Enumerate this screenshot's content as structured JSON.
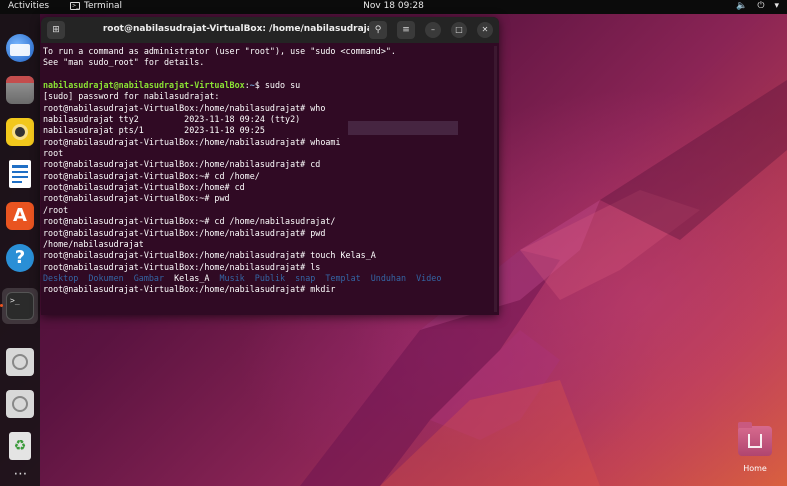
{
  "topbar": {
    "activities": "Activities",
    "app_name": "Terminal",
    "clock": "Nov 18  09:28",
    "icons": [
      "volume-icon",
      "power-icon",
      "chevron-down-icon"
    ]
  },
  "dock": {
    "items": [
      {
        "name": "thunderbird-icon"
      },
      {
        "name": "files-icon"
      },
      {
        "name": "rhythmbox-icon"
      },
      {
        "name": "writer-icon"
      },
      {
        "name": "app-center-icon"
      },
      {
        "name": "help-icon"
      },
      {
        "name": "terminal-icon"
      },
      {
        "name": "disc-icon"
      },
      {
        "name": "disc-icon"
      },
      {
        "name": "trash-icon"
      },
      {
        "name": "show-apps-icon"
      }
    ]
  },
  "terminal": {
    "title": "root@nabilasudrajat-VirtualBox: /home/nabilasudrajat",
    "lines": [
      {
        "segments": [
          {
            "t": "To run a command as administrator (user \"root\"), use \"sudo <command>\".",
            "c": "text"
          }
        ]
      },
      {
        "segments": [
          {
            "t": "See \"man sudo_root\" for details.",
            "c": "text"
          }
        ]
      },
      {
        "segments": [
          {
            "t": "",
            "c": "text"
          }
        ]
      },
      {
        "segments": [
          {
            "t": "nabilasudrajat@nabilasudrajat-VirtualBox",
            "c": "user"
          },
          {
            "t": ":",
            "c": "text"
          },
          {
            "t": "~",
            "c": "path"
          },
          {
            "t": "$ sudo su",
            "c": "text"
          }
        ]
      },
      {
        "segments": [
          {
            "t": "[sudo] password for nabilasudrajat:",
            "c": "text"
          }
        ]
      },
      {
        "segments": [
          {
            "t": "root@nabilasudrajat-VirtualBox:/home/nabilasudrajat# who",
            "c": "text"
          }
        ]
      },
      {
        "segments": [
          {
            "t": "nabilasudrajat tty2         2023-11-18 09:24 (tty2)",
            "c": "text"
          }
        ]
      },
      {
        "segments": [
          {
            "t": "nabilasudrajat pts/1        2023-11-18 09:25",
            "c": "text"
          }
        ]
      },
      {
        "segments": [
          {
            "t": "root@nabilasudrajat-VirtualBox:/home/nabilasudrajat# whoami",
            "c": "text"
          }
        ]
      },
      {
        "segments": [
          {
            "t": "root",
            "c": "text"
          }
        ]
      },
      {
        "segments": [
          {
            "t": "root@nabilasudrajat-VirtualBox:/home/nabilasudrajat# cd",
            "c": "text"
          }
        ]
      },
      {
        "segments": [
          {
            "t": "root@nabilasudrajat-VirtualBox:~# cd /home/",
            "c": "text"
          }
        ]
      },
      {
        "segments": [
          {
            "t": "root@nabilasudrajat-VirtualBox:/home# cd",
            "c": "text"
          }
        ]
      },
      {
        "segments": [
          {
            "t": "root@nabilasudrajat-VirtualBox:~# pwd",
            "c": "text"
          }
        ]
      },
      {
        "segments": [
          {
            "t": "/root",
            "c": "text"
          }
        ]
      },
      {
        "segments": [
          {
            "t": "root@nabilasudrajat-VirtualBox:~# cd /home/nabilasudrajat/",
            "c": "text"
          }
        ]
      },
      {
        "segments": [
          {
            "t": "root@nabilasudrajat-VirtualBox:/home/nabilasudrajat# pwd",
            "c": "text"
          }
        ]
      },
      {
        "segments": [
          {
            "t": "/home/nabilasudrajat",
            "c": "text"
          }
        ]
      },
      {
        "segments": [
          {
            "t": "root@nabilasudrajat-VirtualBox:/home/nabilasudrajat# touch Kelas_A",
            "c": "text"
          }
        ]
      },
      {
        "segments": [
          {
            "t": "root@nabilasudrajat-VirtualBox:/home/nabilasudrajat# ls",
            "c": "text"
          }
        ]
      },
      {
        "segments": [
          {
            "t": "Desktop  Dokumen  Gambar  ",
            "c": "dir"
          },
          {
            "t": "Kelas_A  ",
            "c": "text"
          },
          {
            "t": "Musik  Publik  snap  Templat  Unduhan  Video",
            "c": "dir"
          }
        ]
      },
      {
        "segments": [
          {
            "t": "root@nabilasudrajat-VirtualBox:/home/nabilasudrajat# mkdir",
            "c": "text"
          }
        ]
      }
    ]
  },
  "desktop": {
    "home_label": "Home"
  },
  "colors": {
    "terminal_bg": "#300a24",
    "prompt_user": "#8ae234",
    "prompt_path": "#729fcf",
    "ls_dir": "#3465a4",
    "accent": "#e95420"
  }
}
